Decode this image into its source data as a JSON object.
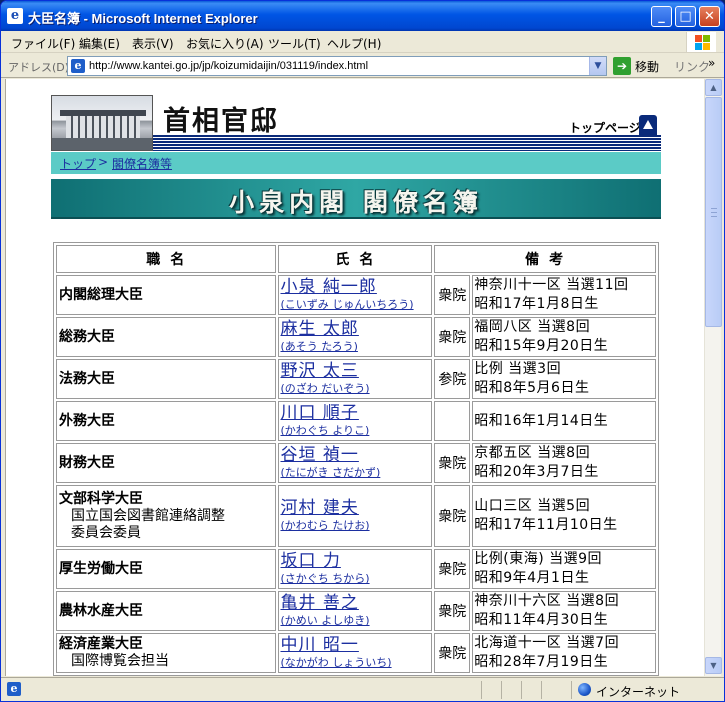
{
  "window": {
    "title": "大臣名簿 - Microsoft Internet Explorer",
    "icon": "ie-page-icon",
    "controls": {
      "minimize": "_",
      "maximize": "□",
      "close": "✕"
    }
  },
  "menu": [
    "ファイル(F)",
    "編集(E)",
    "表示(V)",
    "お気に入り(A)",
    "ツール(T)",
    "ヘルプ(H)"
  ],
  "address": {
    "label": "アドレス(D)",
    "url": "http://www.kantei.go.jp/jp/koizumidaijin/031119/index.html",
    "go_label": "移動",
    "links_label": "リンク",
    "links_chevron": "»"
  },
  "status": {
    "zone": "インターネット"
  },
  "page": {
    "site_title": "首相官邸",
    "top_link": "トップページ",
    "breadcrumb": [
      {
        "label": "トップ"
      },
      {
        "label": "閣僚名簿等"
      }
    ],
    "breadcrumb_sep": ">",
    "heading": "小泉内閣 閣僚名簿",
    "table": {
      "headers": [
        "職名",
        "氏名",
        "備考"
      ],
      "rows": [
        {
          "position": "内閣総理大臣",
          "sub": "",
          "name": "小泉 純一郎",
          "kana": "(こいずみ じゅんいちろう)",
          "house": "衆院",
          "district": "神奈川十一区 当選11回",
          "born": "昭和17年1月8日生"
        },
        {
          "position": "総務大臣",
          "sub": "",
          "name": "麻生 太郎",
          "kana": "(あそう たろう)",
          "house": "衆院",
          "district": "福岡八区 当選8回",
          "born": "昭和15年9月20日生"
        },
        {
          "position": "法務大臣",
          "sub": "",
          "name": "野沢 太三",
          "kana": "(のざわ だいぞう)",
          "house": "参院",
          "district": "比例 当選3回",
          "born": "昭和8年5月6日生"
        },
        {
          "position": "外務大臣",
          "sub": "",
          "name": "川口 順子",
          "kana": "(かわぐち よりこ)",
          "house": "",
          "district": "",
          "born": "昭和16年1月14日生"
        },
        {
          "position": "財務大臣",
          "sub": "",
          "name": "谷垣 禎一",
          "kana": "(たにがき さだかず)",
          "house": "衆院",
          "district": "京都五区 当選8回",
          "born": "昭和20年3月7日生"
        },
        {
          "position": "文部科学大臣",
          "sub": "国立国会図書館連絡調整委員会委員",
          "sub1": "国立国会図書館連絡調整",
          "sub2": "委員会委員",
          "name": "河村 建夫",
          "kana": "(かわむら たけお)",
          "house": "衆院",
          "district": "山口三区 当選5回",
          "born": "昭和17年11月10日生"
        },
        {
          "position": "厚生労働大臣",
          "sub": "",
          "name": "坂口 力",
          "kana": "(さかぐち ちから)",
          "house": "衆院",
          "district": "比例(東海) 当選9回",
          "born": "昭和9年4月1日生"
        },
        {
          "position": "農林水産大臣",
          "sub": "",
          "name": "亀井 善之",
          "kana": "(かめい よしゆき)",
          "house": "衆院",
          "district": "神奈川十六区 当選8回",
          "born": "昭和11年4月30日生"
        },
        {
          "position": "経済産業大臣",
          "sub": "国際博覧会担当",
          "sub1": "国際博覧会担当",
          "name": "中川 昭一",
          "kana": "(なかがわ しょういち)",
          "house": "衆院",
          "district": "北海道十一区 当選7回",
          "born": "昭和28年7月19日生"
        }
      ]
    }
  },
  "colors": {
    "titlebar": "#0055e5",
    "nav_band": "#5bcbc6",
    "heading_band": "#2fa7a4",
    "link": "#1c2fa0"
  }
}
